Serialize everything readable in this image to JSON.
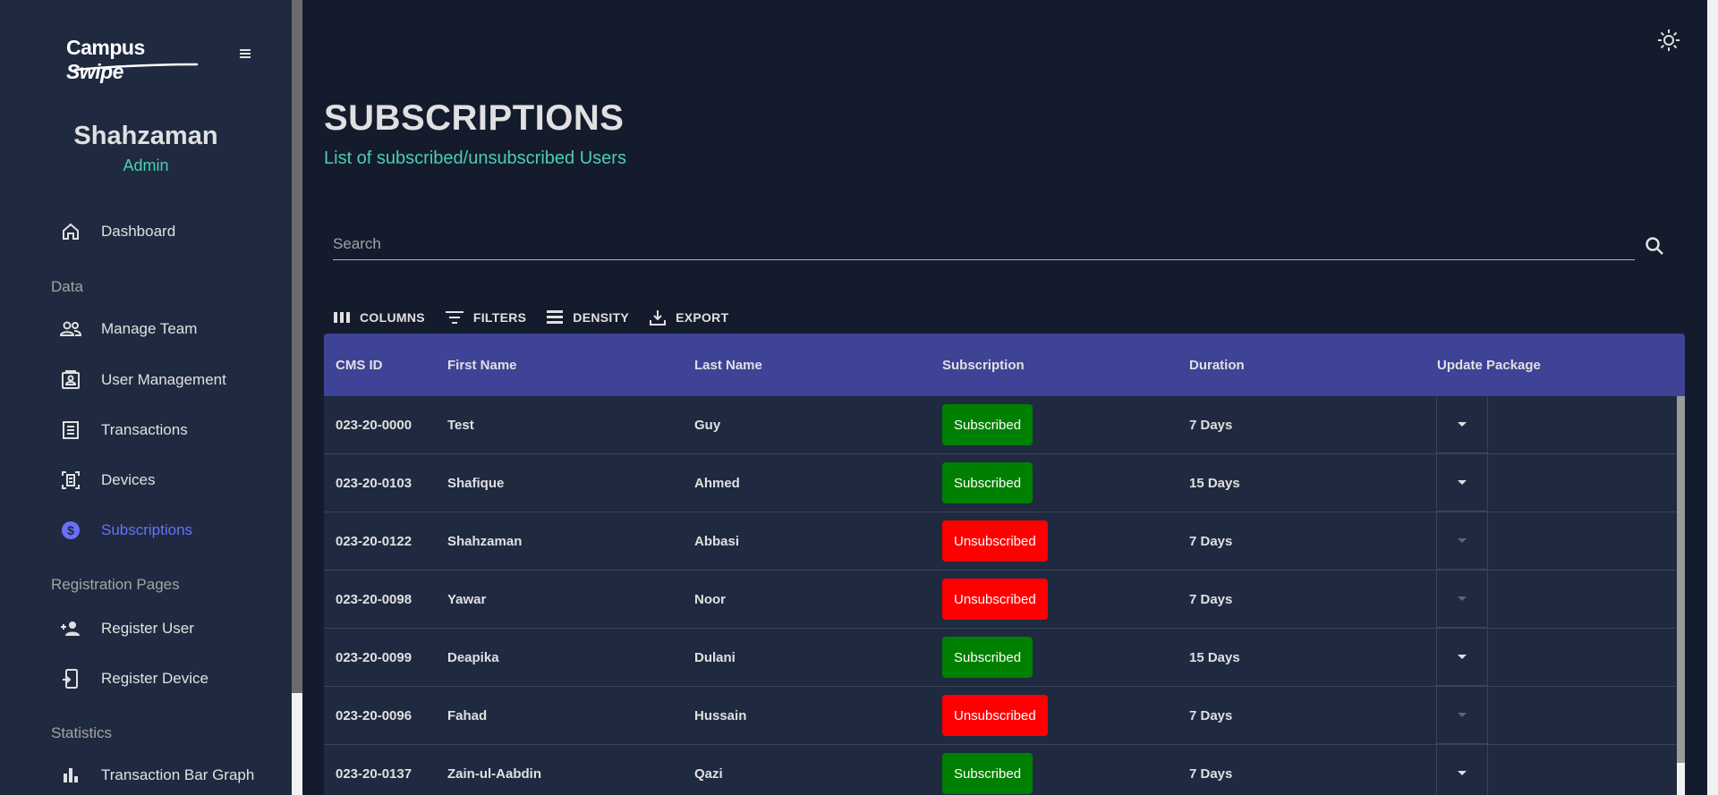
{
  "sidebar": {
    "logo": {
      "text_main": "Campus",
      "text_italic": "Swipe"
    },
    "profile": {
      "name": "Shahzaman",
      "role": "Admin"
    },
    "items": {
      "dashboard": "Dashboard",
      "section_data": "Data",
      "manage_team": "Manage Team",
      "user_management": "User Management",
      "transactions": "Transactions",
      "devices": "Devices",
      "subscriptions": "Subscriptions",
      "section_registration": "Registration Pages",
      "register_user": "Register User",
      "register_device": "Register Device",
      "section_statistics": "Statistics",
      "transaction_bar_graph": "Transaction Bar Graph"
    },
    "active_item": "subscriptions",
    "menu_icon": "hamburger-icon"
  },
  "header": {
    "title": "SUBSCRIPTIONS",
    "subtitle": "List of subscribed/unsubscribed Users",
    "theme_icon": "sun-icon"
  },
  "search": {
    "placeholder": "Search",
    "value": ""
  },
  "toolbar": {
    "columns": "COLUMNS",
    "filters": "FILTERS",
    "density": "DENSITY",
    "export": "EXPORT"
  },
  "table": {
    "headers": {
      "cms_id": "CMS ID",
      "first_name": "First Name",
      "last_name": "Last Name",
      "subscription": "Subscription",
      "duration": "Duration",
      "update_package": "Update Package"
    },
    "rows": [
      {
        "cms_id": "023-20-0000",
        "first_name": "Test",
        "last_name": "Guy",
        "subscription": "Subscribed",
        "duration": "7 Days"
      },
      {
        "cms_id": "023-20-0103",
        "first_name": "Shafique",
        "last_name": "Ahmed",
        "subscription": "Subscribed",
        "duration": "15 Days"
      },
      {
        "cms_id": "023-20-0122",
        "first_name": "Shahzaman",
        "last_name": "Abbasi",
        "subscription": "Unsubscribed",
        "duration": "7 Days"
      },
      {
        "cms_id": "023-20-0098",
        "first_name": "Yawar",
        "last_name": "Noor",
        "subscription": "Unsubscribed",
        "duration": "7 Days"
      },
      {
        "cms_id": "023-20-0099",
        "first_name": "Deapika",
        "last_name": "Dulani",
        "subscription": "Subscribed",
        "duration": "15 Days"
      },
      {
        "cms_id": "023-20-0096",
        "first_name": "Fahad",
        "last_name": "Hussain",
        "subscription": "Unsubscribed",
        "duration": "7 Days"
      },
      {
        "cms_id": "023-20-0137",
        "first_name": "Zain-ul-Aabdin",
        "last_name": "Qazi",
        "subscription": "Subscribed",
        "duration": "7 Days"
      }
    ]
  },
  "colors": {
    "background": "#141b2d",
    "sidebar": "#1f2a40",
    "header_row": "#3e4396",
    "accent_green": "#4cceac",
    "active_nav": "#6870fa",
    "subscribed": "#008000",
    "unsubscribed": "#ff0000"
  }
}
